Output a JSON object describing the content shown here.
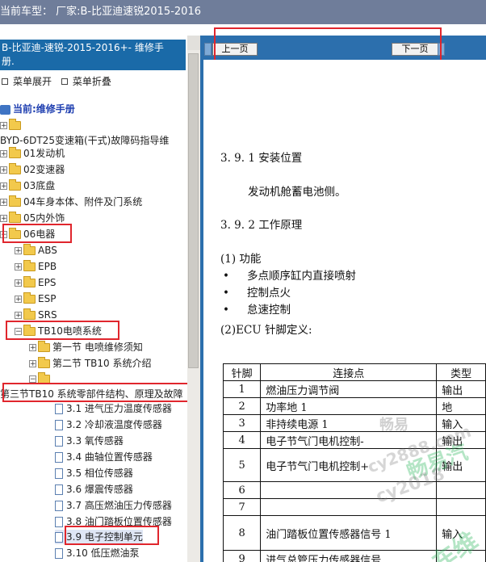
{
  "top_title": "当前车型： 厂家:B-比亚迪速锐2015-2016",
  "left_panel": {
    "header_line1": "B-比亚迪-速锐-2015-2016+- 维修手",
    "header_line2": "册.",
    "expand_label": "菜单展开",
    "collapse_label": "菜单折叠",
    "current_label": "当前:维修手册",
    "tree": [
      {
        "label": ""
      },
      {
        "label": "BYD-6DT25变速箱(干式)故障码指导维"
      },
      {
        "label": "01发动机"
      },
      {
        "label": "02变速器"
      },
      {
        "label": "03底盘"
      },
      {
        "label": "04车身本体、附件及门系统"
      },
      {
        "label": "05内外饰"
      },
      {
        "label": "06电器"
      },
      {
        "label": "ABS"
      },
      {
        "label": "EPB"
      },
      {
        "label": "EPS"
      },
      {
        "label": "ESP"
      },
      {
        "label": "SRS"
      },
      {
        "label": "TB10电喷系统"
      },
      {
        "label": "第一节 电喷维修须知"
      },
      {
        "label": "第二节 TB10 系统介绍"
      },
      {
        "label": ""
      },
      {
        "label": "第三节TB10 系统零部件结构、原理及故障"
      },
      {
        "label": "3.1 进气压力温度传感器"
      },
      {
        "label": "3.2 冷却液温度传感器"
      },
      {
        "label": "3.3 氧传感器"
      },
      {
        "label": "3.4 曲轴位置传感器"
      },
      {
        "label": "3.5 相位传感器"
      },
      {
        "label": "3.6 爆震传感器"
      },
      {
        "label": "3.7 高压燃油压力传感器"
      },
      {
        "label": "3.8 油门踏板位置传感器"
      },
      {
        "label": "3.9 电子控制单元"
      },
      {
        "label": "3.10 低压燃油泵"
      }
    ]
  },
  "nav": {
    "prev": "上一页",
    "next": "下一页"
  },
  "doc": {
    "s1_title": "3. 9. 1  安装位置",
    "s1_body": "发动机舱蓄电池侧。",
    "s2_title": "3. 9. 2  工作原理",
    "func_title": "(1) 功能",
    "func_items": [
      "多点顺序缸内直接喷射",
      "控制点火",
      "怠速控制"
    ],
    "ecu_title": "(2)ECU 针脚定义:",
    "table_headers": [
      "针脚",
      "连接点",
      "类型"
    ],
    "table_rows": [
      {
        "pin": "1",
        "conn": "燃油压力调节阀",
        "type": "输出"
      },
      {
        "pin": "2",
        "conn": "功率地 1",
        "type": "地"
      },
      {
        "pin": "3",
        "conn": "非持续电源 1",
        "type": "输入"
      },
      {
        "pin": "4",
        "conn": "电子节气门电机控制-",
        "type": "输出"
      },
      {
        "pin": "5",
        "conn": "电子节气门电机控制+",
        "type": "输出"
      },
      {
        "pin": "6",
        "conn": "",
        "type": ""
      },
      {
        "pin": "7",
        "conn": "",
        "type": ""
      },
      {
        "pin": "8",
        "conn": "油门踏板位置传感器信号 1",
        "type": "输入"
      },
      {
        "pin": "9",
        "conn": "进气总管压力传感器信号",
        "type": ""
      }
    ],
    "watermark1": "畅易",
    "watermark2": "cy2888.com",
    "watermark3": "畅易汽",
    "watermark4": "cy2018",
    "watermark5": "车维"
  }
}
